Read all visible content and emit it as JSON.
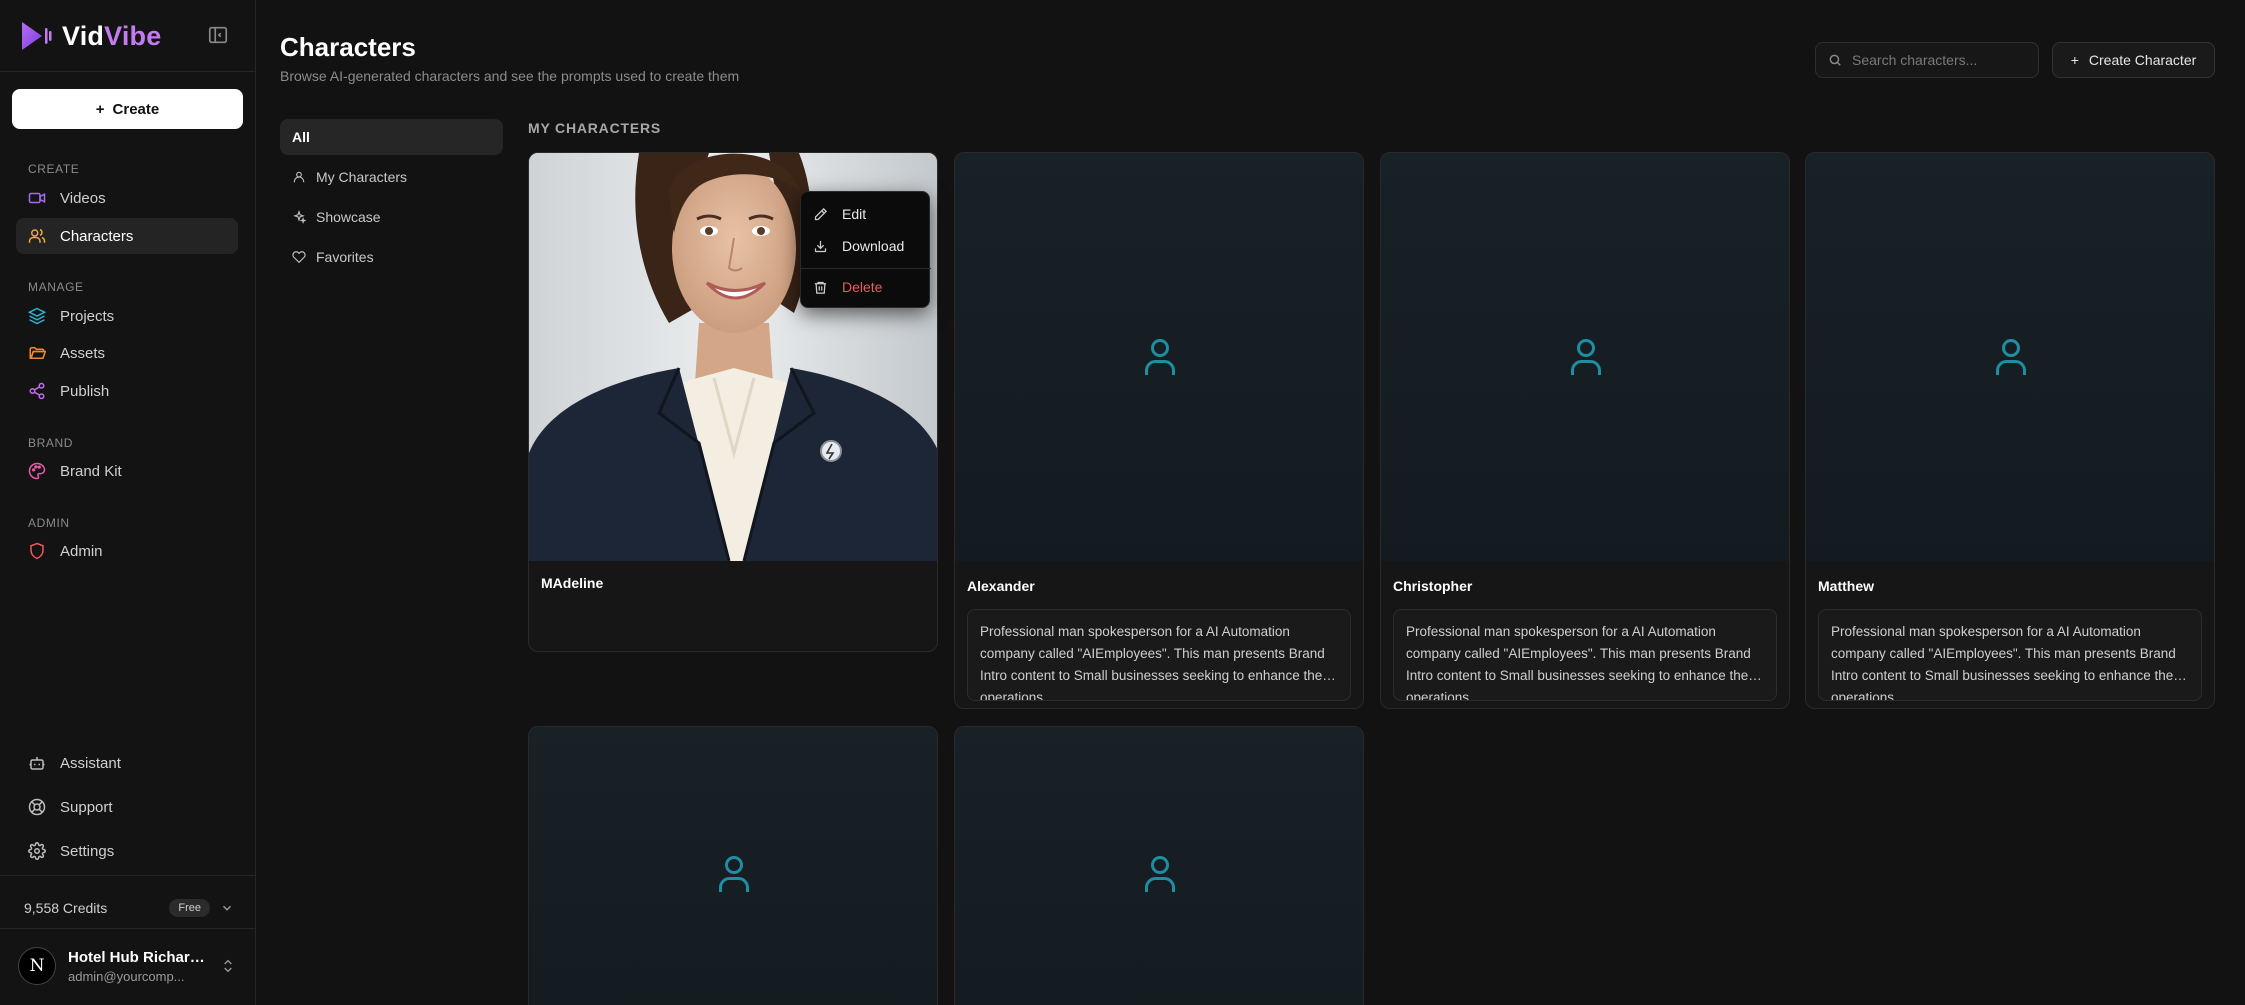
{
  "brand": {
    "name_part1": "Vid",
    "name_part2": "Vibe"
  },
  "sidebar": {
    "create_label": "Create",
    "sections": {
      "create": "CREATE",
      "manage": "MANAGE",
      "brand": "BRAND",
      "admin": "ADMIN"
    },
    "items": {
      "videos": "Videos",
      "characters": "Characters",
      "projects": "Projects",
      "assets": "Assets",
      "publish": "Publish",
      "brand_kit": "Brand Kit",
      "admin": "Admin",
      "assistant": "Assistant",
      "support": "Support",
      "settings": "Settings"
    },
    "credits": "9,558 Credits",
    "plan": "Free",
    "user": {
      "avatar_letter": "N",
      "name": "Hotel Hub Richard...",
      "email": "admin@yourcomp..."
    }
  },
  "header": {
    "title": "Characters",
    "subtitle": "Browse AI-generated characters and see the prompts used to create them",
    "search_placeholder": "Search characters...",
    "create_character_label": "Create Character"
  },
  "filters": {
    "all": "All",
    "my_characters": "My Characters",
    "showcase": "Showcase",
    "favorites": "Favorites"
  },
  "group_label": "MY CHARACTERS",
  "characters": [
    {
      "name": "MAdeline",
      "prompt": ""
    },
    {
      "name": "Alexander",
      "prompt": "Professional man spokesperson for a AI Automation company called \"AIEmployees\". This man presents Brand Intro content to Small businesses seeking to enhance their operations."
    },
    {
      "name": "Christopher",
      "prompt": "Professional man spokesperson for a AI Automation company called \"AIEmployees\". This man presents Brand Intro content to Small businesses seeking to enhance their operations."
    },
    {
      "name": "Matthew",
      "prompt": "Professional man spokesperson for a AI Automation company called \"AIEmployees\". This man presents Brand Intro content to Small businesses seeking to enhance their operations."
    }
  ],
  "context_menu": {
    "edit": "Edit",
    "download": "Download",
    "delete": "Delete"
  },
  "colors": {
    "accent": "#c47bf0",
    "placeholder_icon": "#1e8ea0",
    "danger": "#ef5a5a"
  }
}
